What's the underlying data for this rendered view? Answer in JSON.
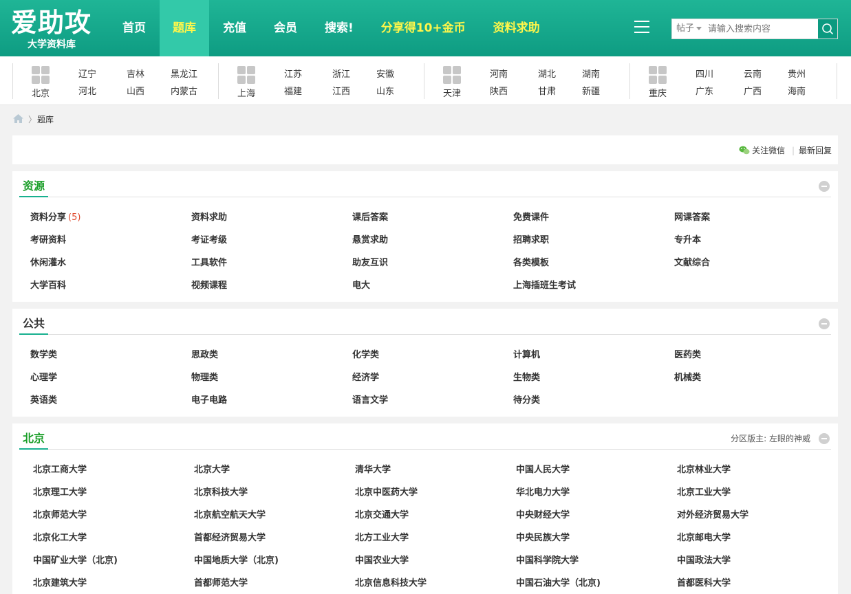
{
  "logo": {
    "main": "爱助攻",
    "sub": "大学资料库"
  },
  "nav": [
    {
      "label": "首页",
      "style": "normal"
    },
    {
      "label": "题库",
      "style": "active"
    },
    {
      "label": "充值",
      "style": "normal"
    },
    {
      "label": "会员",
      "style": "normal"
    },
    {
      "label": "搜索!",
      "style": "normal"
    },
    {
      "label": "分享得10+金币",
      "style": "yellow"
    },
    {
      "label": "资料求助",
      "style": "yellow"
    }
  ],
  "search": {
    "type_label": "帖子",
    "placeholder": "请输入搜索内容"
  },
  "province_groups": [
    {
      "main": "北京",
      "links": [
        "辽宁",
        "吉林",
        "黑龙江",
        "河北",
        "山西",
        "内蒙古"
      ]
    },
    {
      "main": "上海",
      "links": [
        "江苏",
        "浙江",
        "安徽",
        "福建",
        "江西",
        "山东"
      ]
    },
    {
      "main": "天津",
      "links": [
        "河南",
        "湖北",
        "湖南",
        "陕西",
        "甘肃",
        "新疆"
      ]
    },
    {
      "main": "重庆",
      "links": [
        "四川",
        "云南",
        "贵州",
        "广东",
        "广西",
        "海南"
      ]
    }
  ],
  "breadcrumb": {
    "separator": "〉",
    "current": "题库"
  },
  "toolbar": {
    "wechat": "关注微信",
    "latest": "最新回复"
  },
  "sections": {
    "resources": {
      "title": "资源",
      "items": [
        {
          "label": "资料分享",
          "count": "(5)"
        },
        {
          "label": "资料求助"
        },
        {
          "label": "课后答案"
        },
        {
          "label": "免费课件"
        },
        {
          "label": "网课答案"
        },
        {
          "label": "考研资料"
        },
        {
          "label": "考证考级"
        },
        {
          "label": "悬赏求助"
        },
        {
          "label": "招聘求职"
        },
        {
          "label": "专升本"
        },
        {
          "label": "休闲灌水"
        },
        {
          "label": "工具软件"
        },
        {
          "label": "助友互识"
        },
        {
          "label": "各类模板"
        },
        {
          "label": "文献综合"
        },
        {
          "label": "大学百科"
        },
        {
          "label": "视频课程"
        },
        {
          "label": "电大"
        },
        {
          "label": "上海插班生考试"
        }
      ]
    },
    "public": {
      "title": "公共",
      "items": [
        {
          "label": "数学类"
        },
        {
          "label": "思政类"
        },
        {
          "label": "化学类"
        },
        {
          "label": "计算机"
        },
        {
          "label": "医药类"
        },
        {
          "label": "心理学"
        },
        {
          "label": "物理类"
        },
        {
          "label": "经济学"
        },
        {
          "label": "生物类"
        },
        {
          "label": "机械类"
        },
        {
          "label": "英语类"
        },
        {
          "label": "电子电路"
        },
        {
          "label": "语言文学"
        },
        {
          "label": "待分类"
        }
      ]
    },
    "beijing": {
      "title": "北京",
      "moderator": "分区版主: 左眼的神威",
      "items": [
        "北京工商大学",
        "北京大学",
        "清华大学",
        "中国人民大学",
        "北京林业大学",
        "北京理工大学",
        "北京科技大学",
        "北京中医药大学",
        "华北电力大学",
        "北京工业大学",
        "北京师范大学",
        "北京航空航天大学",
        "北京交通大学",
        "中央财经大学",
        "对外经济贸易大学",
        "北京化工大学",
        "首都经济贸易大学",
        "北方工业大学",
        "中央民族大学",
        "北京邮电大学",
        "中国矿业大学（北京)",
        "中国地质大学（北京)",
        "中国农业大学",
        "中国科学院大学",
        "中国政法大学",
        "北京建筑大学",
        "首都师范大学",
        "北京信息科技大学",
        "中国石油大学（北京)",
        "首都医科大学"
      ]
    }
  }
}
